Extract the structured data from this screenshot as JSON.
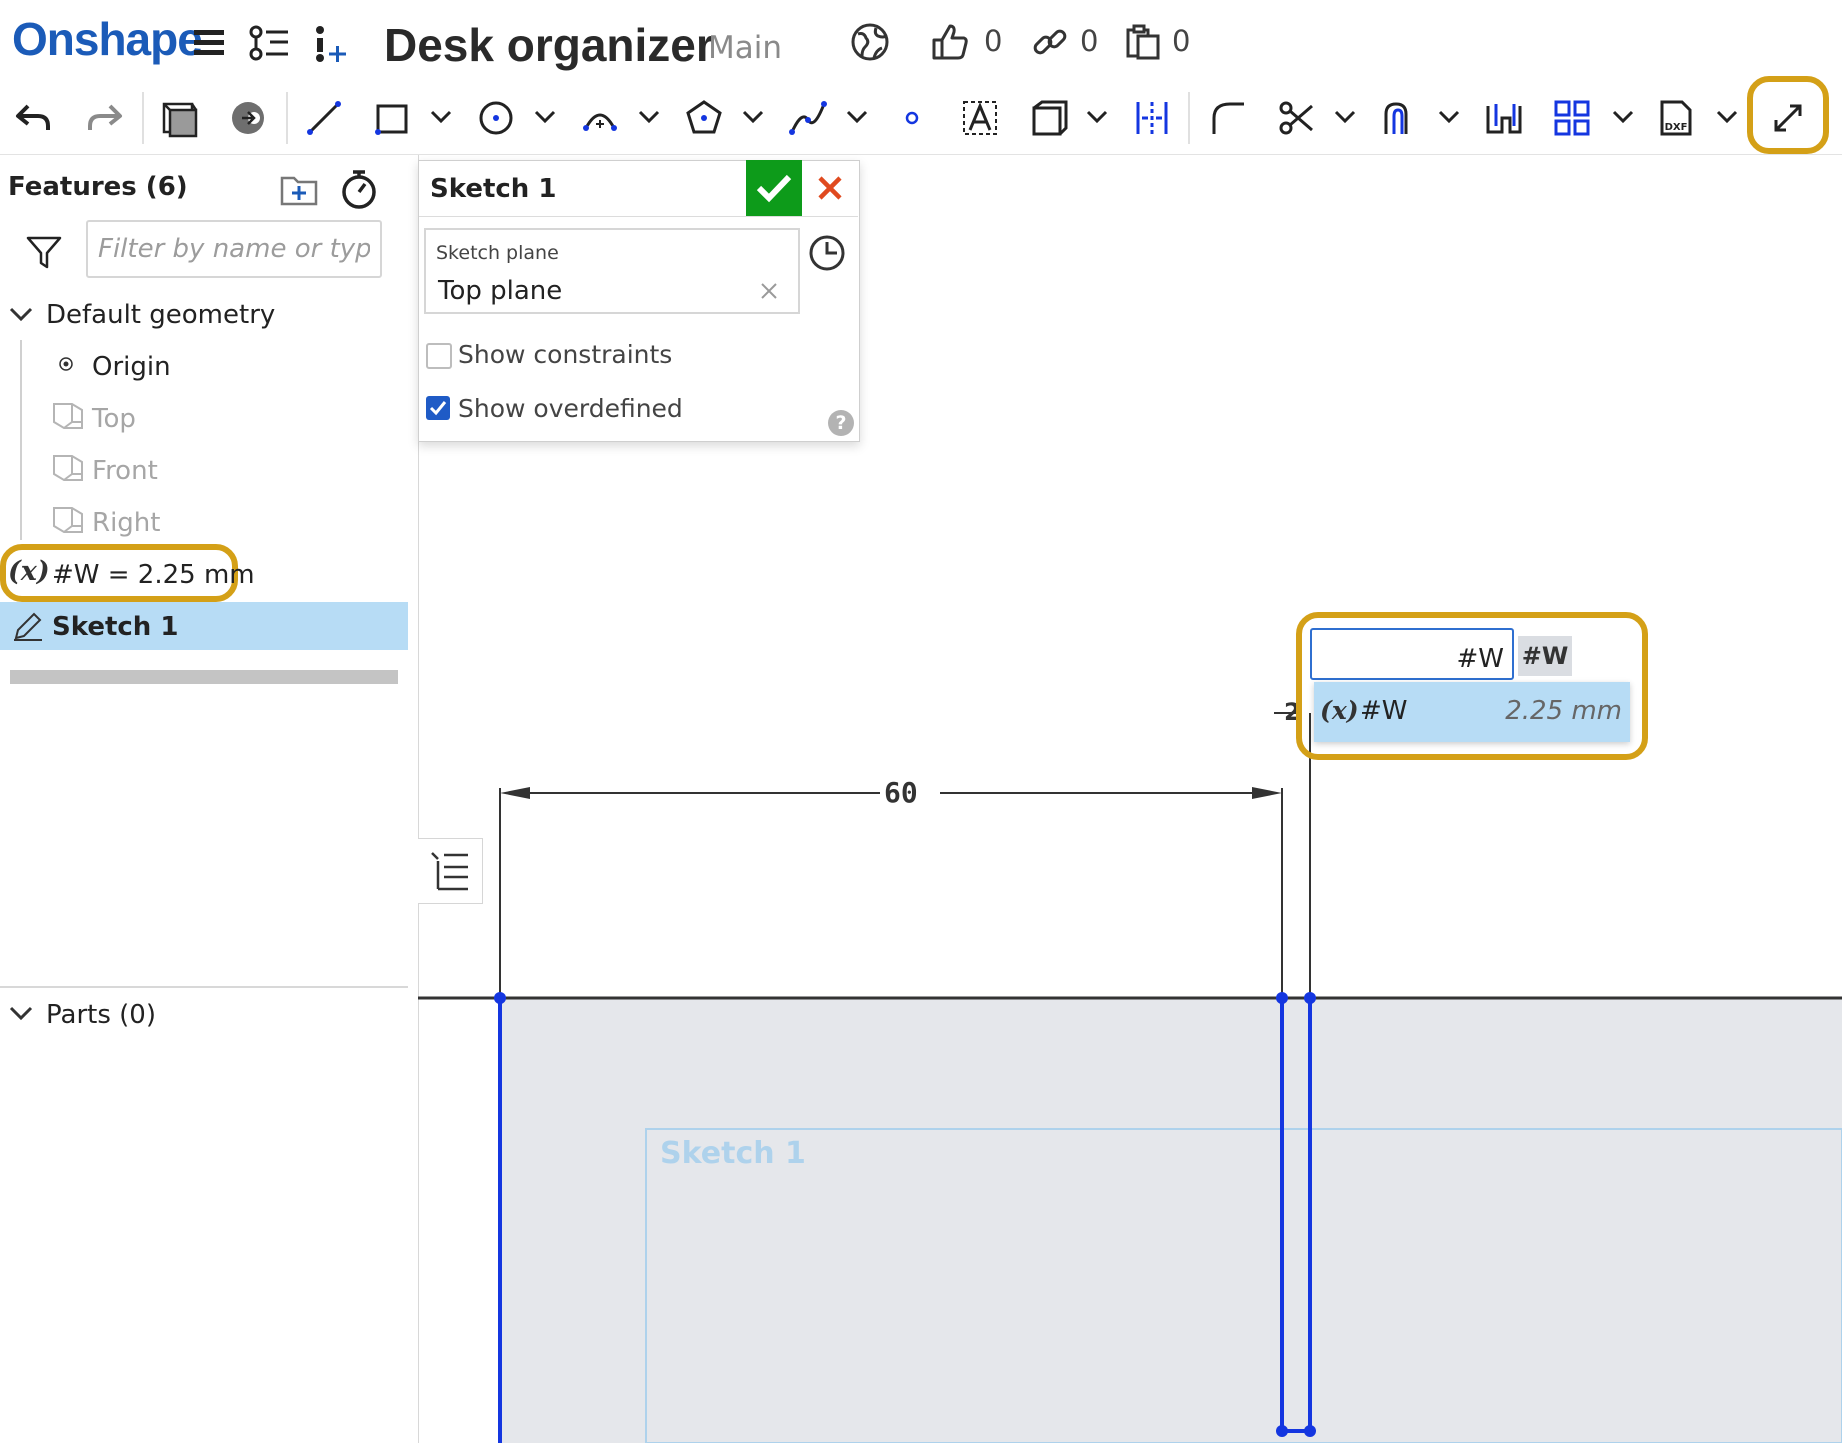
{
  "header": {
    "logo": "Onshape",
    "document_title": "Desk organizer",
    "branch": "Main",
    "likes_count": "0",
    "links_count": "0",
    "copies_count": "0"
  },
  "toolbar": {
    "icons": [
      "undo-icon",
      "redo-icon",
      "sketch-icon",
      "appearance-icon",
      "line-icon",
      "rectangle-icon",
      "circle-icon",
      "arc-icon",
      "polygon-icon",
      "spline-icon",
      "point-icon",
      "text-icon",
      "construction-icon",
      "mirror-icon",
      "fillet-icon",
      "trim-icon",
      "offset-icon",
      "use-icon",
      "pattern-icon",
      "dxf-icon",
      "dimension-icon"
    ]
  },
  "features_panel": {
    "title": "Features (6)",
    "filter_placeholder": "Filter by name or type",
    "default_geometry_label": "Default geometry",
    "items": [
      {
        "label": "Origin"
      },
      {
        "label": "Top"
      },
      {
        "label": "Front"
      },
      {
        "label": "Right"
      }
    ],
    "variable_item": "#W = 2.25 mm",
    "sketch_item": "Sketch 1",
    "parts_label": "Parts (0)"
  },
  "sketch_dialog": {
    "title": "Sketch 1",
    "plane_label": "Sketch plane",
    "plane_value": "Top plane",
    "show_constraints_label": "Show constraints",
    "show_constraints_checked": false,
    "show_overdefined_label": "Show overdefined",
    "show_overdefined_checked": true
  },
  "canvas": {
    "dimension_60": "60",
    "dimension_partial": "2",
    "sketch_label": "Sketch 1",
    "dimension_input_value": "#W",
    "autocomplete_chip": "#W",
    "suggestion_name": "#W",
    "suggestion_value": "2.25 mm"
  },
  "colors": {
    "brand": "#1b5bb8",
    "highlight": "#d4a017",
    "accept_green": "#0d9b1a",
    "cancel_red": "#e04a1f",
    "sketch_blue": "#1436e0",
    "selected_row": "#b7dcf5"
  }
}
